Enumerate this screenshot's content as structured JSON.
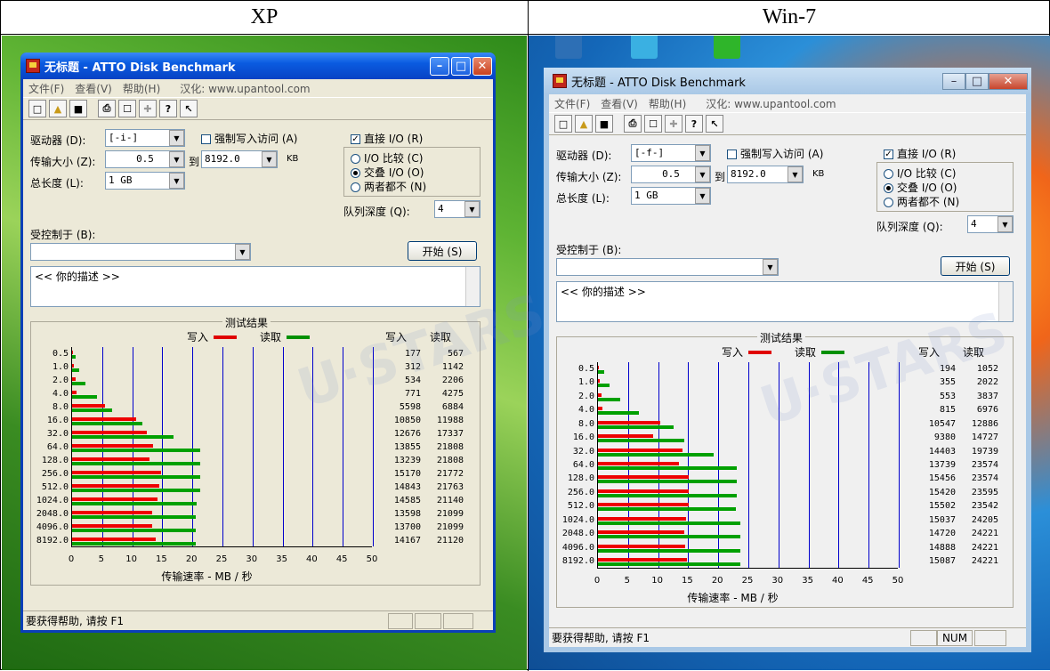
{
  "headers": {
    "left": "XP",
    "right": "Win-7"
  },
  "xp": {
    "title": "无标题 - ATTO Disk Benchmark",
    "menu": [
      "文件(F)",
      "查看(V)",
      "帮助(H)"
    ],
    "menu_url": "汉化: www.upantool.com",
    "drive_label": "驱动器 (D):",
    "drive_value": "[-i-]",
    "force_write_label": "强制写入访问 (A)",
    "direct_io_label": "直接 I/O (R)",
    "io_compare_label": "I/O 比较 (C)",
    "overlap_io_label": "交叠 I/O (O)",
    "neither_label": "两者都不 (N)",
    "transfer_label": "传输大小 (Z):",
    "transfer_from": "0.5",
    "to_label": "到",
    "transfer_to": "8192.0",
    "kb_label": "KB",
    "total_label": "总长度 (L):",
    "total_value": "1 GB",
    "queue_label": "队列深度 (Q):",
    "queue_value": "4",
    "controlled_label": "受控制于 (B):",
    "start_label": "开始 (S)",
    "desc_text": "<<   你的描述    >>",
    "results_title": "测试结果",
    "legend_write": "写入",
    "legend_read": "读取",
    "col_write": "写入",
    "col_read": "读取",
    "xlabel": "传输速率 - MB / 秒",
    "status": "要获得帮助, 请按 F1"
  },
  "w7": {
    "title": "无标题 - ATTO Disk Benchmark",
    "menu": [
      "文件(F)",
      "查看(V)",
      "帮助(H)"
    ],
    "menu_url": "汉化: www.upantool.com",
    "drive_label": "驱动器 (D):",
    "drive_value": "[-f-]",
    "force_write_label": "强制写入访问 (A)",
    "direct_io_label": "直接 I/O (R)",
    "io_compare_label": "I/O 比较 (C)",
    "overlap_io_label": "交叠 I/O (O)",
    "neither_label": "两者都不 (N)",
    "transfer_label": "传输大小 (Z):",
    "transfer_from": "0.5",
    "to_label": "到",
    "transfer_to": "8192.0",
    "kb_label": "KB",
    "total_label": "总长度 (L):",
    "total_value": "1 GB",
    "queue_label": "队列深度 (Q):",
    "queue_value": "4",
    "controlled_label": "受控制于 (B):",
    "start_label": "开始 (S)",
    "desc_text": "<<   你的描述    >>",
    "results_title": "测试结果",
    "legend_write": "写入",
    "legend_read": "读取",
    "col_write": "写入",
    "col_read": "读取",
    "xlabel": "传输速率 - MB / 秒",
    "status": "要获得帮助, 请按 F1",
    "num_indicator": "NUM"
  },
  "chart_data": [
    {
      "type": "bar",
      "orientation": "horizontal",
      "categories": [
        "0.5",
        "1.0",
        "2.0",
        "4.0",
        "8.0",
        "16.0",
        "32.0",
        "64.0",
        "128.0",
        "256.0",
        "512.0",
        "1024.0",
        "2048.0",
        "4096.0",
        "8192.0"
      ],
      "series": [
        {
          "name": "写入",
          "color": "#ee0000",
          "values": [
            177,
            312,
            534,
            771,
            5598,
            10850,
            12676,
            13855,
            13239,
            15170,
            14843,
            14585,
            13598,
            13700,
            14167
          ]
        },
        {
          "name": "读取",
          "color": "#00a000",
          "values": [
            567,
            1142,
            2206,
            4275,
            6884,
            11988,
            17337,
            21808,
            21808,
            21772,
            21763,
            21140,
            21099,
            21099,
            21120
          ]
        }
      ],
      "xticks": [
        "0",
        "5",
        "10",
        "15",
        "20",
        "25",
        "30",
        "35",
        "40",
        "45",
        "50"
      ],
      "xlim": [
        0,
        50
      ],
      "xlabel": "传输速率 - MB / 秒"
    },
    {
      "type": "bar",
      "orientation": "horizontal",
      "categories": [
        "0.5",
        "1.0",
        "2.0",
        "4.0",
        "8.0",
        "16.0",
        "32.0",
        "64.0",
        "128.0",
        "256.0",
        "512.0",
        "1024.0",
        "2048.0",
        "4096.0",
        "8192.0"
      ],
      "series": [
        {
          "name": "写入",
          "color": "#ee0000",
          "values": [
            194,
            355,
            553,
            815,
            10547,
            9380,
            14403,
            13739,
            15456,
            15420,
            15502,
            15037,
            14720,
            14888,
            15087
          ]
        },
        {
          "name": "读取",
          "color": "#00a000",
          "values": [
            1052,
            2022,
            3837,
            6976,
            12886,
            14727,
            19739,
            23574,
            23574,
            23595,
            23542,
            24205,
            24221,
            24221,
            24221
          ]
        }
      ],
      "xticks": [
        "0",
        "5",
        "10",
        "15",
        "20",
        "25",
        "30",
        "35",
        "40",
        "45",
        "50"
      ],
      "xlim": [
        0,
        50
      ],
      "xlabel": "传输速率 - MB / 秒"
    }
  ]
}
